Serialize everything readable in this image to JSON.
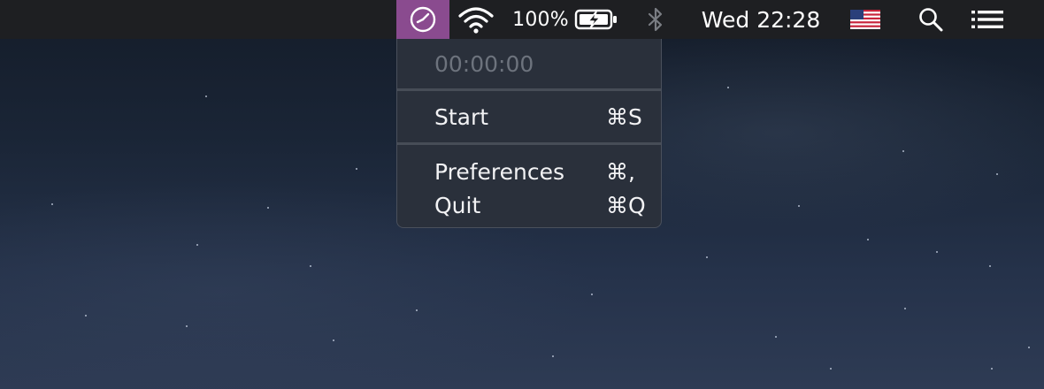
{
  "menubar": {
    "battery_percent": "100%",
    "clock": "Wed 22:28",
    "icons": [
      "timer-icon",
      "wifi-icon",
      "battery-charging-icon",
      "bluetooth-icon",
      "us-flag-icon",
      "search-icon",
      "notification-list-icon"
    ]
  },
  "menu": {
    "timer_value": "00:00:00",
    "items": [
      {
        "label": "Start",
        "shortcut": "⌘S"
      },
      {
        "label": "Preferences",
        "shortcut": "⌘,"
      },
      {
        "label": "Quit",
        "shortcut": "⌘Q"
      }
    ]
  },
  "colors": {
    "menubar": "#1e1f22",
    "active_icon_highlight": "#8a4b8f",
    "menu_background": "#2a303b",
    "menu_text": "#f2f2f4",
    "disabled_text": "#6d737d"
  }
}
